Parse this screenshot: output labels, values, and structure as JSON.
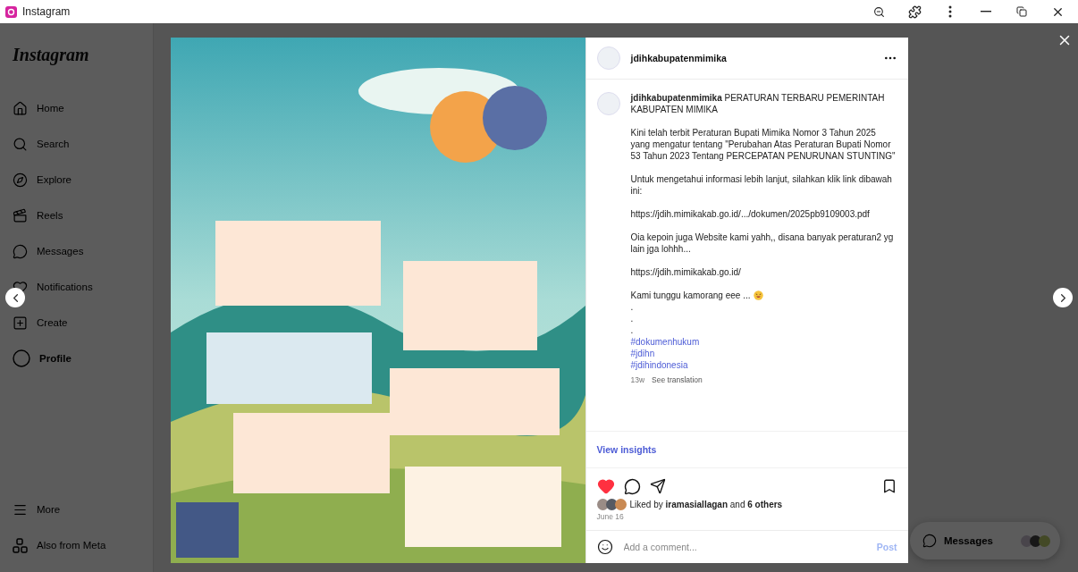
{
  "window": {
    "title": "Instagram"
  },
  "sidebar": {
    "logo": "Instagram",
    "items": [
      {
        "label": "Home",
        "selected": false
      },
      {
        "label": "Search",
        "selected": false
      },
      {
        "label": "Explore",
        "selected": false
      },
      {
        "label": "Reels",
        "selected": false
      },
      {
        "label": "Messages",
        "selected": false
      },
      {
        "label": "Notifications",
        "selected": false
      },
      {
        "label": "Create",
        "selected": false
      },
      {
        "label": "Profile",
        "selected": true
      }
    ],
    "bottom_items": [
      {
        "label": "More"
      },
      {
        "label": "Also from Meta"
      }
    ]
  },
  "post": {
    "username": "jdihkabupatenmimika",
    "caption": [
      {
        "kind": "paragraph",
        "text": "**jdihkabupatenmimika** PERATURAN TERBARU PEMERINTAH KABUPATEN MIMIKA"
      },
      {
        "kind": "paragraph",
        "text": "Kini telah terbit Peraturan Bupati Mimika Nomor 3 Tahun 2025 yang mengatur tentang \"Perubahan Atas Peraturan Bupati Nomor 53 Tahun 2023 Tentang PERCEPATAN PENURUNAN STUNTING\""
      },
      {
        "kind": "paragraph",
        "text": "Untuk mengetahui informasi lebih lanjut, silahkan klik link dibawah ini:"
      },
      {
        "kind": "paragraph",
        "text": "https://jdih.mimikakab.go.id/.../dokumen/2025pb9109003.pdf"
      },
      {
        "kind": "paragraph",
        "text": "Oia kepoin juga Website kami yahh,, disana banyak peraturan2 yg lain jga lohhh..."
      },
      {
        "kind": "paragraph",
        "text": "https://jdih.mimikakab.go.id/"
      },
      {
        "kind": "emoji_line",
        "text": "Kami tunggu kamorang eee ..."
      },
      {
        "kind": "line",
        "text": "."
      },
      {
        "kind": "line",
        "text": "."
      },
      {
        "kind": "line",
        "text": "."
      },
      {
        "kind": "hashtag",
        "text": "#dokumenhukum"
      },
      {
        "kind": "hashtag",
        "text": "#jdihn"
      },
      {
        "kind": "hashtag",
        "text": "#jdihindonesia"
      }
    ],
    "age": "13w",
    "translate": "See translation",
    "insights": "View insights",
    "liked": true,
    "likes": "Liked by **iramasiallagan** and **6 others**",
    "date": "June 16",
    "comment": {
      "placeholder": "Add a comment...",
      "post": "Post"
    }
  },
  "messages": {
    "label": "Messages"
  }
}
